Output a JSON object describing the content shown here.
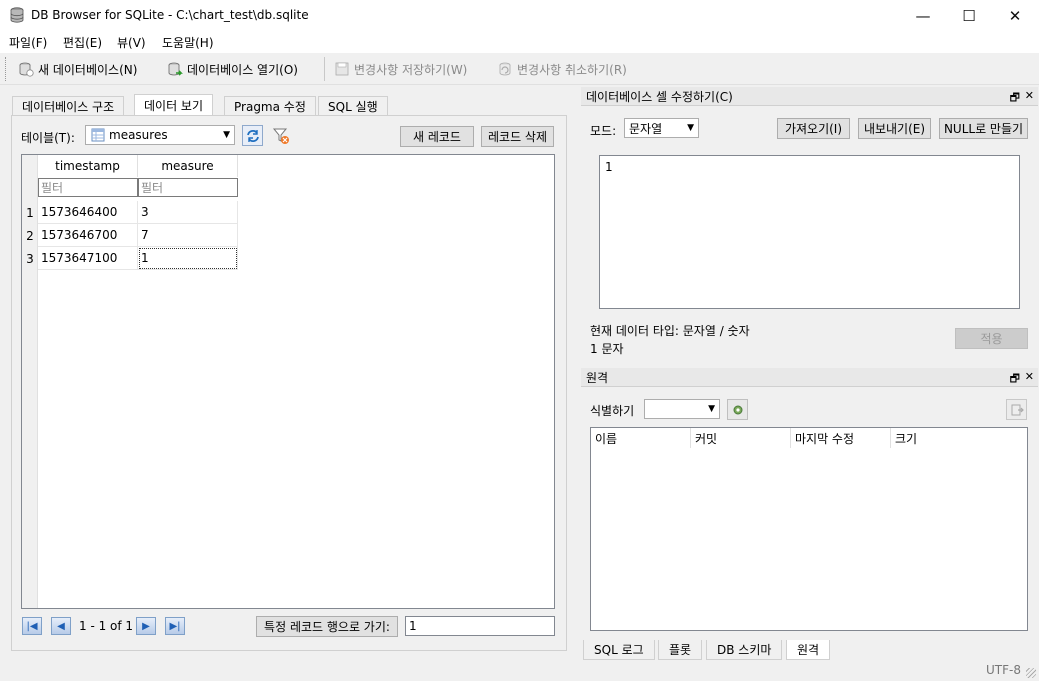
{
  "window": {
    "title": "DB Browser for SQLite - C:\\chart_test\\db.sqlite",
    "minimize": "—",
    "maximize": "☐",
    "close": "✕"
  },
  "menu": [
    "파일(F)",
    "편집(E)",
    "뷰(V)",
    "도움말(H)"
  ],
  "toolbar": {
    "new_db": "새 데이터베이스(N)",
    "open_db": "데이터베이스 열기(O)",
    "write_changes": "변경사항 저장하기(W)",
    "revert_changes": "변경사항 취소하기(R)"
  },
  "tabs": [
    "데이터베이스 구조",
    "데이터 보기",
    "Pragma 수정",
    "SQL 실행"
  ],
  "browse": {
    "table_label": "테이블(T):",
    "table_name": "measures",
    "new_record": "새 레코드",
    "delete_record": "레코드 삭제",
    "columns": [
      "timestamp",
      "measure"
    ],
    "filter_placeholder": "필터",
    "rows": [
      {
        "num": "1",
        "timestamp": "1573646400",
        "measure": "3"
      },
      {
        "num": "2",
        "timestamp": "1573646700",
        "measure": "7"
      },
      {
        "num": "3",
        "timestamp": "1573647100",
        "measure": "1"
      }
    ],
    "pager": "1 - 1 of 1",
    "goto_label": "특정 레코드 행으로 가기:",
    "goto_value": "1"
  },
  "edit_cell": {
    "title": "데이터베이스 셀 수정하기(C)",
    "mode_label": "모드:",
    "mode_value": "문자열",
    "import": "가져오기(I)",
    "export": "내보내기(E)",
    "set_null": "NULL로 만들기",
    "content": "1",
    "type_info": "현재 데이터 타입: 문자열 / 숫자",
    "size_info": "1 문자",
    "apply": "적용"
  },
  "remote": {
    "title": "원격",
    "identity_label": "식별하기",
    "columns": [
      "이름",
      "커밋",
      "마지막 수정",
      "크기"
    ]
  },
  "bottom_tabs": [
    "SQL 로그",
    "플롯",
    "DB 스키마",
    "원격"
  ],
  "status": {
    "encoding": "UTF-8"
  },
  "dock_controls": {
    "float": "🗗",
    "close": "✕"
  }
}
